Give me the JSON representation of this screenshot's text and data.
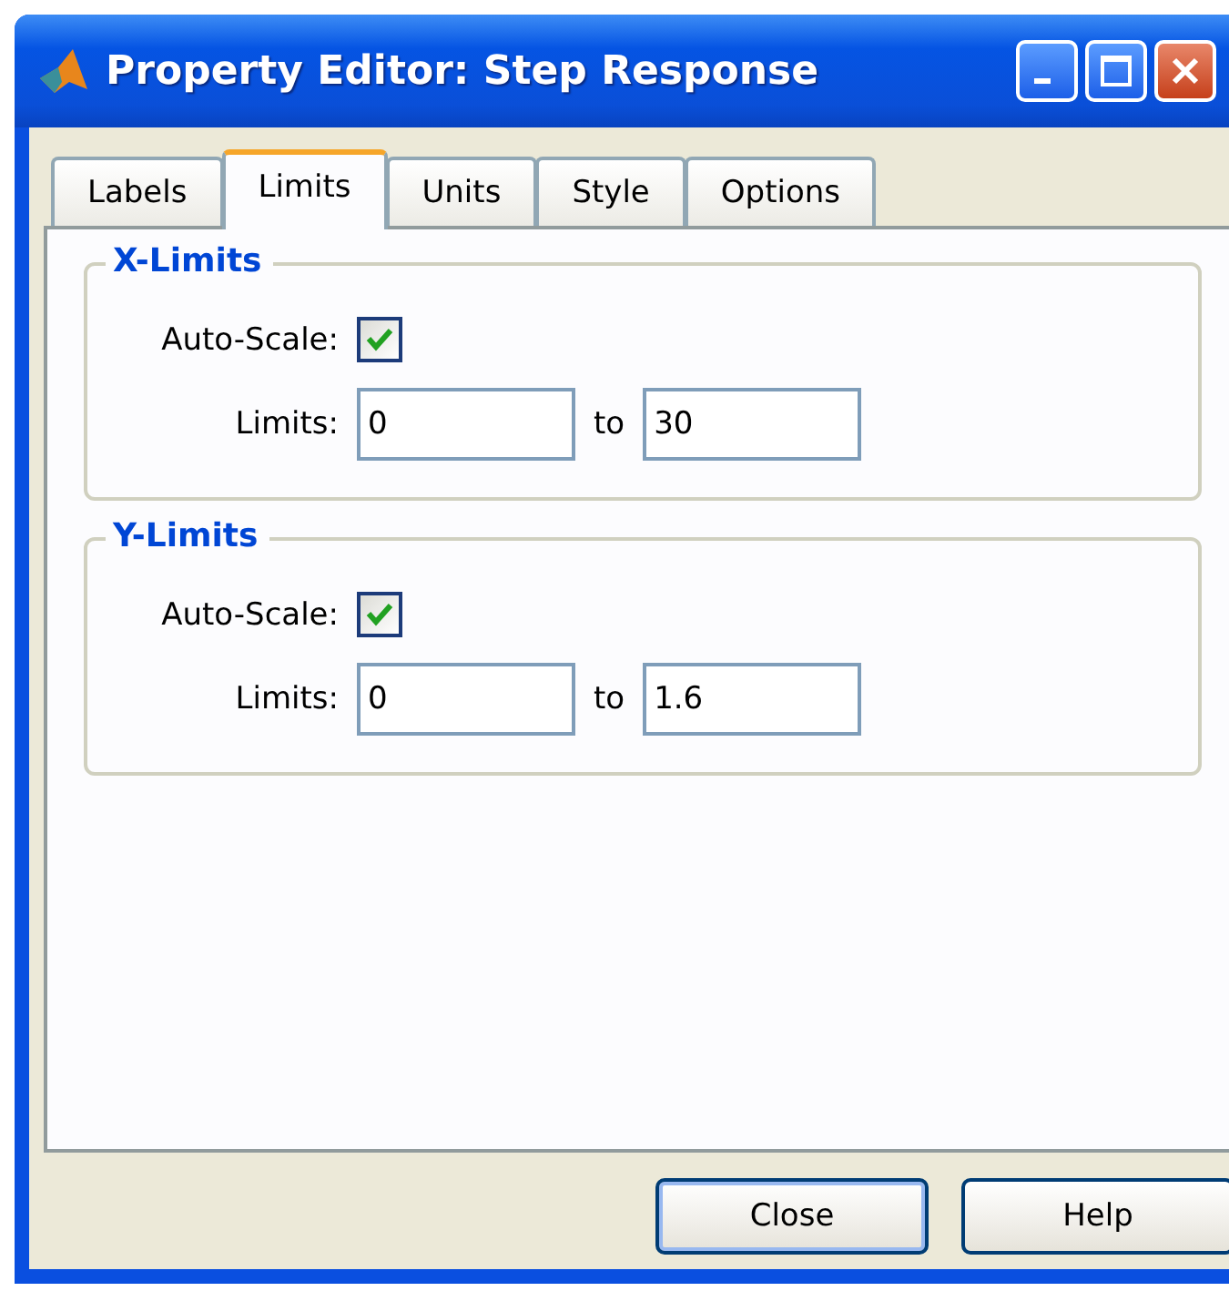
{
  "window": {
    "title": "Property Editor: Step Response"
  },
  "tabs": [
    {
      "label": "Labels",
      "selected": false
    },
    {
      "label": "Limits",
      "selected": true
    },
    {
      "label": "Units",
      "selected": false
    },
    {
      "label": "Style",
      "selected": false
    },
    {
      "label": "Options",
      "selected": false
    }
  ],
  "groups": [
    {
      "title": "X-Limits",
      "auto_scale": {
        "label": "Auto-Scale:",
        "checked": true
      },
      "limits": {
        "label": "Limits:",
        "from": "0",
        "separator": "to",
        "to": "30"
      }
    },
    {
      "title": "Y-Limits",
      "auto_scale": {
        "label": "Auto-Scale:",
        "checked": true
      },
      "limits": {
        "label": "Limits:",
        "from": "0",
        "separator": "to",
        "to": "1.6"
      }
    }
  ],
  "buttons": [
    {
      "label": "Close",
      "default": true
    },
    {
      "label": "Help",
      "default": false
    }
  ]
}
